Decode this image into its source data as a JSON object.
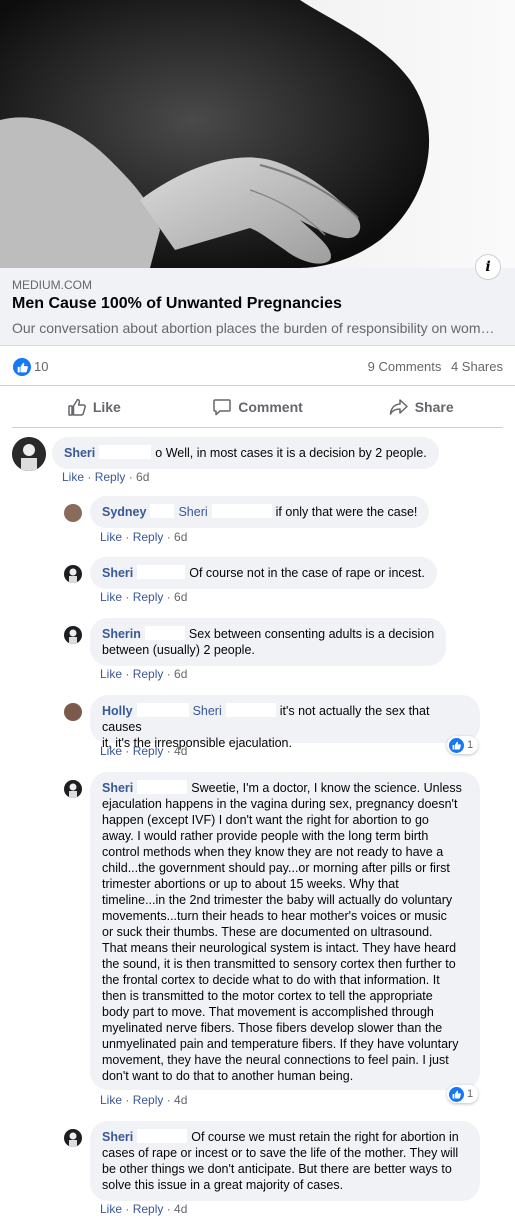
{
  "link_preview": {
    "domain": "MEDIUM.COM",
    "title": "Men Cause 100% of Unwanted Pregnancies",
    "description": "Our conversation about abortion places the burden of responsibility on wom…",
    "info_icon": "info-icon"
  },
  "stats": {
    "likes": "10",
    "comments": "9 Comments",
    "shares": "4 Shares"
  },
  "actions": {
    "like": "Like",
    "comment": "Comment",
    "share": "Share"
  },
  "comments": [
    {
      "author": "Sheri",
      "tail": "o",
      "text": "Well, in most cases it is a decision by 2 people.",
      "like": "Like",
      "reply": "Reply",
      "time": "6d"
    },
    {
      "author": "Sydney",
      "mention": "Sheri",
      "text": "if only that were the case!",
      "like": "Like",
      "reply": "Reply",
      "time": "6d"
    },
    {
      "author": "Sheri",
      "text": "Of course not in the case of rape or incest.",
      "like": "Like",
      "reply": "Reply",
      "time": "6d"
    },
    {
      "author": "Sherin",
      "text_line1": "Sex between consenting adults is a decision",
      "text_line2": "between (usually) 2 people.",
      "like": "Like",
      "reply": "Reply",
      "time": "6d"
    },
    {
      "author": "Holly",
      "mention": "Sheri",
      "text_line1": "it's not actually the sex that causes",
      "text_line2": "it, it's the irresponsible ejaculation.",
      "like": "Like",
      "reply": "Reply",
      "time": "4d",
      "reactions": "1"
    },
    {
      "author": "Sheri",
      "text_first": "Sweetie, I'm a doctor, I know the science. Unless",
      "lines": [
        "ejaculation happens in the vagina during sex, pregnancy doesn't",
        "happen (except IVF) I don't want the right for abortion to go",
        "away. I would rather provide people with the long term birth",
        "control methods when they know they are not ready to have a",
        "child...the government should pay...or morning after pills or first",
        "trimester abortions or up to about 15 weeks. Why that",
        "timeline...in the 2nd trimester the baby will actually do voluntary",
        "movements...turn their heads to hear mother's voices or music",
        "or suck their thumbs. These are documented on ultrasound.",
        "That means their neurological system is intact. They have heard",
        "the sound, it is then transmitted to sensory cortex then further to",
        "the frontal cortex to decide what to do with that information. It",
        "then is transmitted to the motor cortex to tell the appropriate",
        "body part to move. That movement is accomplished through",
        "myelinated nerve fibers. Those fibers develop slower than the",
        "unmyelinated pain and temperature fibers. If they have voluntary",
        "movement, they have the neural connections to feel pain. I just",
        "don't want to do that to another human being."
      ],
      "like": "Like",
      "reply": "Reply",
      "time": "4d",
      "reactions": "1"
    },
    {
      "author": "Sheri",
      "text_first": "Of course we must retain the right for abortion in",
      "lines": [
        "cases of rape or incest or to save the life of the mother. They will",
        "be other things we don't anticipate. But there are better ways to",
        "solve this issue in a great majority of cases."
      ],
      "like": "Like",
      "reply": "Reply",
      "time": "4d"
    }
  ],
  "colors": {
    "link_blue": "#385898",
    "like_blue": "#1877f2",
    "bubble_bg": "#f0f2f5",
    "meta_gray": "#65676b"
  }
}
